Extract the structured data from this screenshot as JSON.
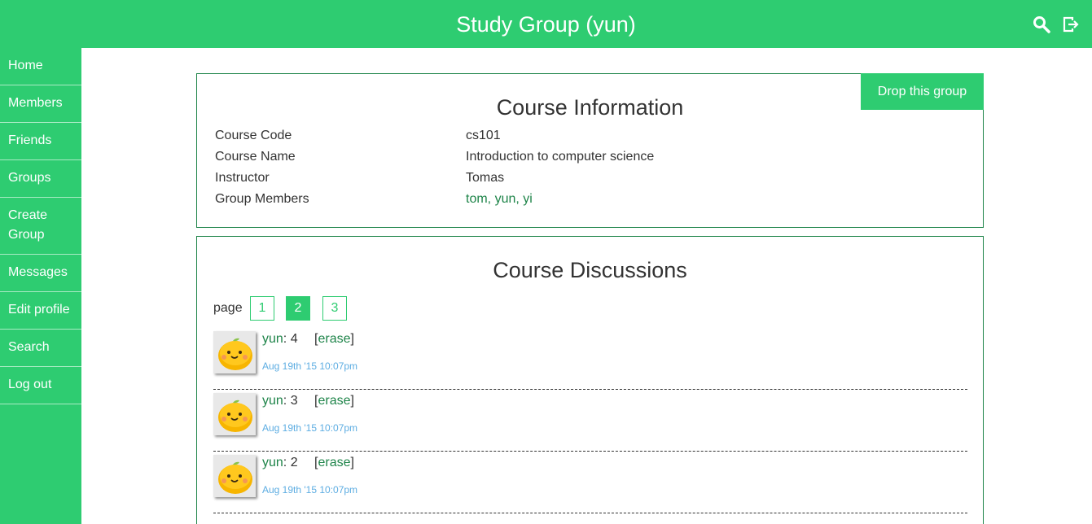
{
  "header": {
    "title": "Study Group (yun)",
    "icons": [
      "search-icon",
      "logout-icon"
    ]
  },
  "sidebar": {
    "items": [
      {
        "label": "Home"
      },
      {
        "label": "Members"
      },
      {
        "label": "Friends"
      },
      {
        "label": "Groups"
      },
      {
        "label": "Create Group"
      },
      {
        "label": "Messages"
      },
      {
        "label": "Edit profile"
      },
      {
        "label": "Search"
      },
      {
        "label": "Log out"
      }
    ]
  },
  "course_info": {
    "title": "Course Information",
    "drop_button": "Drop this group",
    "rows": [
      {
        "label": "Course Code",
        "value": "cs101"
      },
      {
        "label": "Course Name",
        "value": "Introduction to computer science"
      },
      {
        "label": "Instructor",
        "value": "Tomas"
      },
      {
        "label": "Group Members",
        "value": "tom, yun, yi"
      }
    ]
  },
  "discussions": {
    "title": "Course Discussions",
    "page_label": "page",
    "pages": [
      "1",
      "2",
      "3"
    ],
    "current_page": "2",
    "posts": [
      {
        "author": "yun",
        "text": ": 4",
        "erase_open": "[",
        "erase": "erase",
        "erase_close": "]",
        "time": "Aug 19th '15 10:07pm",
        "avatar": "orange-avatar"
      },
      {
        "author": "yun",
        "text": ": 3",
        "erase_open": "[",
        "erase": "erase",
        "erase_close": "]",
        "time": "Aug 19th '15 10:07pm",
        "avatar": "orange-avatar"
      },
      {
        "author": "yun",
        "text": ": 2",
        "erase_open": "[",
        "erase": "erase",
        "erase_close": "]",
        "time": "Aug 19th '15 10:07pm",
        "avatar": "orange-avatar"
      }
    ]
  },
  "colors": {
    "brand_green": "#2ecc71",
    "dark_green": "#1e8449",
    "timestamp_blue": "#5dade2"
  }
}
